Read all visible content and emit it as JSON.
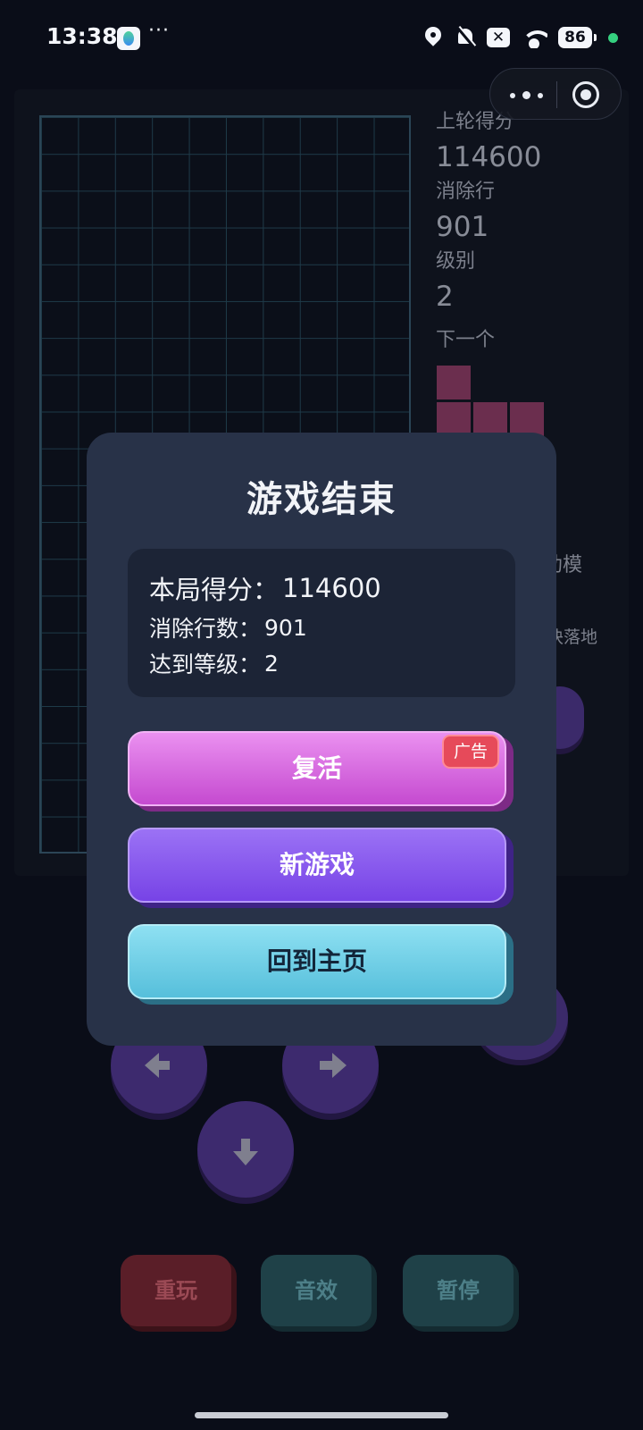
{
  "status_bar": {
    "time": "13:38",
    "more": "···",
    "battery": "86",
    "xbox_glyph": "✕",
    "icons": [
      "location-icon",
      "bell-off-icon",
      "close-box-icon",
      "wifi-icon",
      "battery-icon"
    ]
  },
  "game": {
    "last_score_label": "上轮得分",
    "last_score_value": "114600",
    "lines_label": "消除行",
    "lines_value": "901",
    "level_label": "级别",
    "level_value": "2",
    "next_label": "下一个",
    "partial_mode_text": "助模",
    "partial_drop_text": "块落地",
    "next_piece_color": "#6b2e4e"
  },
  "controls": {
    "replay": "重玩",
    "sound": "音效",
    "pause": "暂停"
  },
  "modal": {
    "title": "游戏结束",
    "score_label": "本局得分：",
    "score_value": "114600",
    "lines_label": "消除行数：",
    "lines_value": "901",
    "level_label": "达到等级：",
    "level_value": "2",
    "revive": "复活",
    "ad_badge": "广告",
    "new_game": "新游戏",
    "home": "回到主页"
  },
  "colors": {
    "background": "#0a0d18",
    "modal": "#283248",
    "revive": "#c54ad0",
    "new_game": "#7743e6",
    "home": "#56bfdb",
    "ad": "#e64a5a"
  }
}
